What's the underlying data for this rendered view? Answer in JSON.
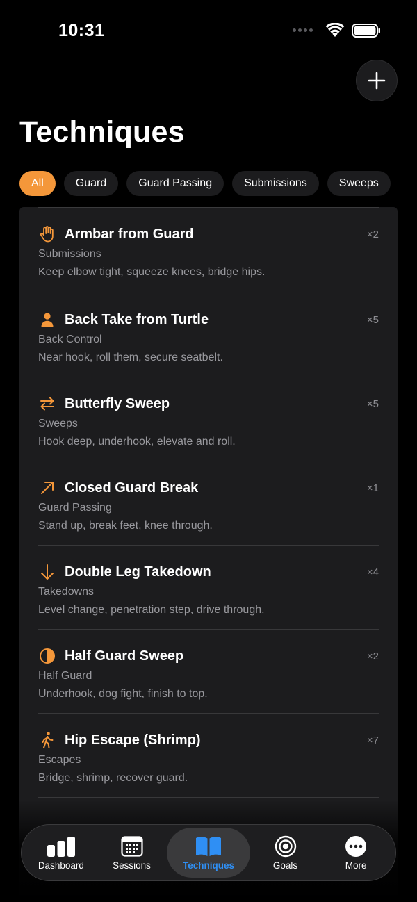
{
  "status": {
    "time": "10:31"
  },
  "header": {
    "title": "Techniques",
    "add_label": "+"
  },
  "filters": [
    {
      "label": "All",
      "active": true
    },
    {
      "label": "Guard"
    },
    {
      "label": "Guard Passing"
    },
    {
      "label": "Submissions"
    },
    {
      "label": "Sweeps"
    }
  ],
  "techniques": [
    {
      "title": "Armbar from Guard",
      "category": "Submissions",
      "note": "Keep elbow tight, squeeze knees, bridge hips.",
      "count": "×2",
      "icon": "hand-icon"
    },
    {
      "title": "Back Take from Turtle",
      "category": "Back Control",
      "note": "Near hook, roll them, secure seatbelt.",
      "count": "×5",
      "icon": "person-icon"
    },
    {
      "title": "Butterfly Sweep",
      "category": "Sweeps",
      "note": "Hook deep, underhook, elevate and roll.",
      "count": "×5",
      "icon": "swap-arrows-icon"
    },
    {
      "title": "Closed Guard Break",
      "category": "Guard Passing",
      "note": "Stand up, break feet, knee through.",
      "count": "×1",
      "icon": "arrow-up-right-icon"
    },
    {
      "title": "Double Leg Takedown",
      "category": "Takedowns",
      "note": "Level change, penetration step, drive through.",
      "count": "×4",
      "icon": "arrow-down-icon"
    },
    {
      "title": "Half Guard Sweep",
      "category": "Half Guard",
      "note": "Underhook, dog fight, finish to top.",
      "count": "×2",
      "icon": "half-circle-icon"
    },
    {
      "title": "Hip Escape (Shrimp)",
      "category": "Escapes",
      "note": "Bridge, shrimp, recover guard.",
      "count": "×7",
      "icon": "walking-figure-icon"
    }
  ],
  "tabs": [
    {
      "label": "Dashboard",
      "icon": "bar-chart-icon"
    },
    {
      "label": "Sessions",
      "icon": "calendar-icon"
    },
    {
      "label": "Techniques",
      "icon": "book-icon",
      "active": true
    },
    {
      "label": "Goals",
      "icon": "target-icon"
    },
    {
      "label": "More",
      "icon": "ellipsis-circle-icon"
    }
  ],
  "colors": {
    "accent": "#f4973a",
    "tab_active": "#2f8ff4",
    "card": "#1c1c1e",
    "background": "#000000"
  }
}
